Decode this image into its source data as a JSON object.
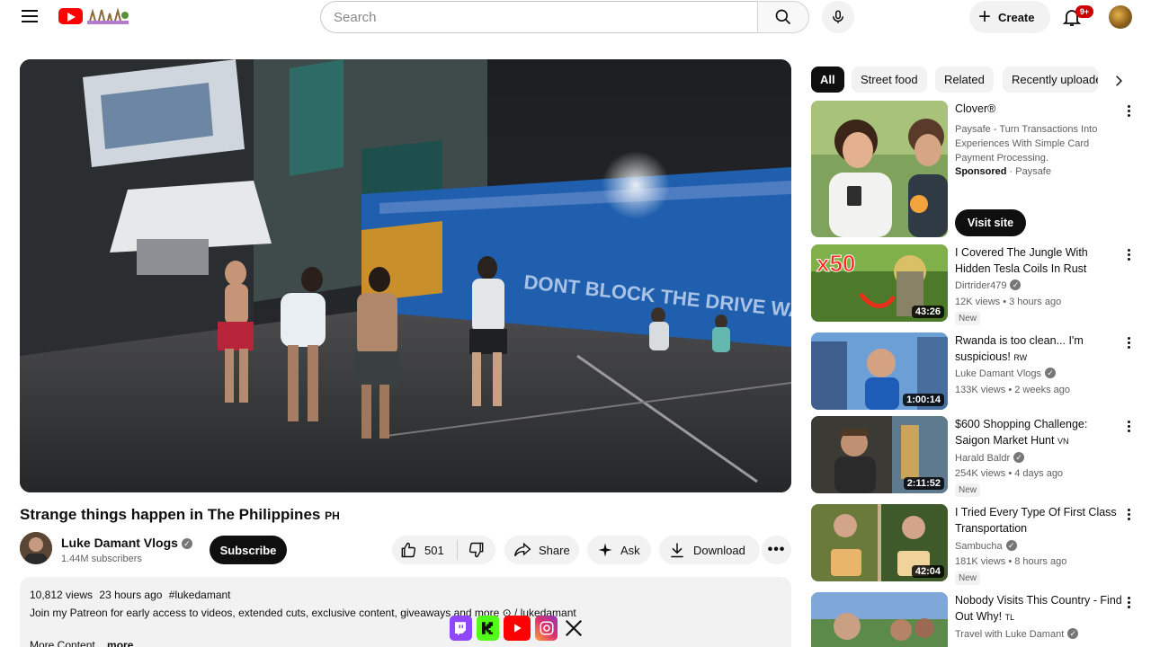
{
  "header": {
    "search_placeholder": "Search",
    "create_label": "Create",
    "notification_count": "9+"
  },
  "video": {
    "title": "Strange things happen in The Philippines",
    "title_flag": "PH",
    "channel": "Luke Damant Vlogs",
    "subscribers": "1.44M subscribers",
    "subscribe_label": "Subscribe",
    "likes": "501",
    "share_label": "Share",
    "ask_label": "Ask",
    "download_label": "Download",
    "description": {
      "views": "10,812 views",
      "time": "23 hours ago",
      "hashtag": "#lukedamant",
      "text": "Join my Patreon for early access to videos, extended cuts, exclusive content, giveaways and more",
      "link": "/ lukedamant",
      "more_text": "More Content",
      "more_label": "...more"
    }
  },
  "chips": [
    "All",
    "Street food",
    "Related",
    "Recently uploaded"
  ],
  "sidebar": {
    "ad": {
      "title": "Clover®",
      "description": "Paysafe - Turn Transactions Into Experiences With Simple Card Payment Processing.",
      "sponsored_label": "Sponsored",
      "advertiser": "Paysafe",
      "cta": "Visit site"
    },
    "videos": [
      {
        "title": "I Covered The Jungle With Hidden Tesla Coils In Rust",
        "flag": "",
        "channel": "Dirtrider479",
        "views": "12K views",
        "age": "3 hours ago",
        "new": "New",
        "duration": "43:26"
      },
      {
        "title": "Rwanda is too clean... I'm suspicious!",
        "flag": "RW",
        "channel": "Luke Damant Vlogs",
        "views": "133K views",
        "age": "2 weeks ago",
        "new": "",
        "duration": "1:00:14"
      },
      {
        "title": "$600 Shopping Challenge: Saigon Market Hunt",
        "flag": "VN",
        "channel": "Harald Baldr",
        "views": "254K views",
        "age": "4 days ago",
        "new": "New",
        "duration": "2:11:52"
      },
      {
        "title": "I Tried Every Type Of First Class Transportation",
        "flag": "",
        "channel": "Sambucha",
        "views": "181K views",
        "age": "8 hours ago",
        "new": "New",
        "duration": "42:04"
      },
      {
        "title": "Nobody Visits This Country - Find Out Why!",
        "flag": "TL",
        "channel": "Travel with Luke Damant",
        "views": "",
        "age": "",
        "new": "",
        "duration": ""
      }
    ]
  },
  "icons": {
    "menu": "menu-icon",
    "search": "search-icon",
    "mic": "mic-icon",
    "bell": "bell-icon",
    "like": "thumbs-up-icon",
    "dislike": "thumbs-down-icon",
    "share": "share-arrow-icon",
    "ask": "sparkle-icon",
    "download": "download-icon",
    "more": "more-horizontal-icon"
  },
  "colors": {
    "brand_red": "#ff0000",
    "badge_red": "#cc0000",
    "chip_bg": "#f2f2f2",
    "text": "#0f0f0f",
    "muted": "#606060"
  }
}
